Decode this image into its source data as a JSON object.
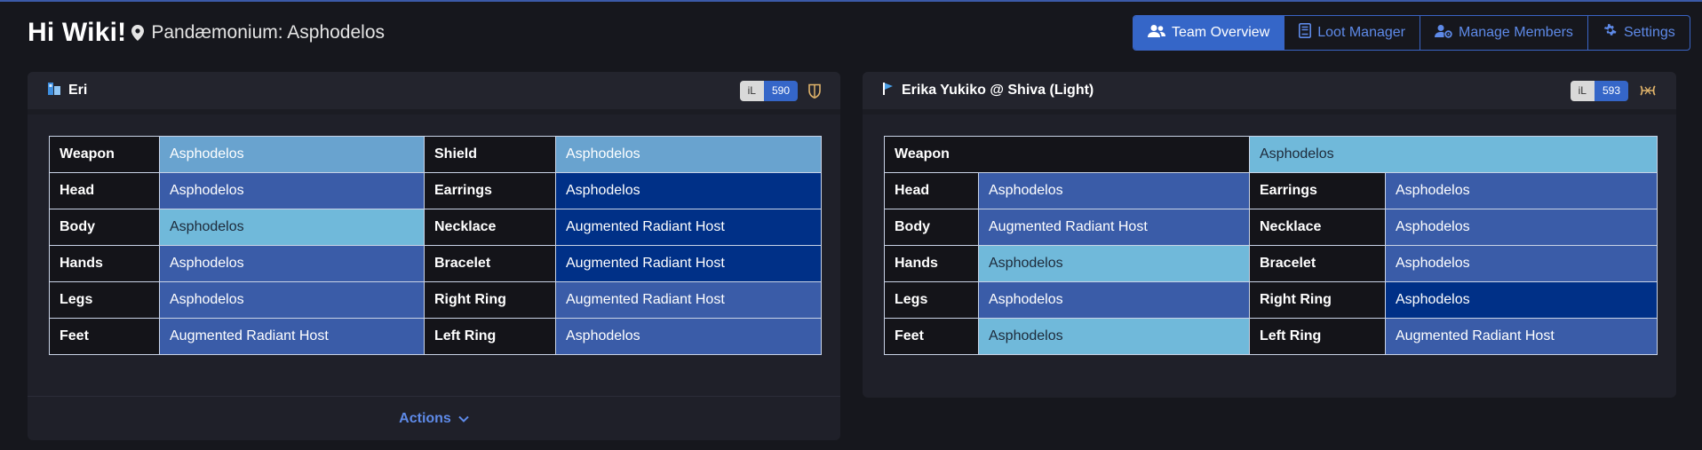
{
  "header": {
    "greeting": "Hi Wiki!",
    "location": "Pandæmonium: Asphodelos"
  },
  "nav": [
    {
      "label": "Team Overview",
      "icon": "users-icon",
      "active": true
    },
    {
      "label": "Loot Manager",
      "icon": "book-icon",
      "active": false
    },
    {
      "label": "Manage Members",
      "icon": "user-cog-icon",
      "active": false
    },
    {
      "label": "Settings",
      "icon": "gear-icon",
      "active": false
    }
  ],
  "colors": {
    "light": "#70b9da",
    "mid": "#69a3cf",
    "blue": "#3a5ca8",
    "navy": "#003087",
    "accent": "#3566c8"
  },
  "members": [
    {
      "name": "Eri",
      "job_icon": "paladin-job-icon",
      "il_label": "iL",
      "il_value": "590",
      "role_icon": "tank-shield-icon",
      "actions_label": "Actions",
      "rows": [
        [
          {
            "label": "Weapon",
            "value": "Asphodelos",
            "tone": "mid"
          },
          {
            "label": "Shield",
            "value": "Asphodelos",
            "tone": "mid"
          }
        ],
        [
          {
            "label": "Head",
            "value": "Asphodelos",
            "tone": "blue"
          },
          {
            "label": "Earrings",
            "value": "Asphodelos",
            "tone": "navy"
          }
        ],
        [
          {
            "label": "Body",
            "value": "Asphodelos",
            "tone": "light"
          },
          {
            "label": "Necklace",
            "value": "Augmented Radiant Host",
            "tone": "navy"
          }
        ],
        [
          {
            "label": "Hands",
            "value": "Asphodelos",
            "tone": "blue"
          },
          {
            "label": "Bracelet",
            "value": "Augmented Radiant Host",
            "tone": "navy"
          }
        ],
        [
          {
            "label": "Legs",
            "value": "Asphodelos",
            "tone": "blue"
          },
          {
            "label": "Right Ring",
            "value": "Augmented Radiant Host",
            "tone": "blue"
          }
        ],
        [
          {
            "label": "Feet",
            "value": "Augmented Radiant Host",
            "tone": "blue"
          },
          {
            "label": "Left Ring",
            "value": "Asphodelos",
            "tone": "blue"
          }
        ]
      ]
    },
    {
      "name": "Erika Yukiko @ Shiva (Light)",
      "job_icon": "dancer-job-icon",
      "il_label": "iL",
      "il_value": "593",
      "role_icon": "ranged-dps-icon",
      "weapon": {
        "label": "Weapon",
        "value": "Asphodelos",
        "tone": "light"
      },
      "rows": [
        [
          {
            "label": "Head",
            "value": "Asphodelos",
            "tone": "blue"
          },
          {
            "label": "Earrings",
            "value": "Asphodelos",
            "tone": "blue"
          }
        ],
        [
          {
            "label": "Body",
            "value": "Augmented Radiant Host",
            "tone": "blue"
          },
          {
            "label": "Necklace",
            "value": "Asphodelos",
            "tone": "blue"
          }
        ],
        [
          {
            "label": "Hands",
            "value": "Asphodelos",
            "tone": "light"
          },
          {
            "label": "Bracelet",
            "value": "Asphodelos",
            "tone": "blue"
          }
        ],
        [
          {
            "label": "Legs",
            "value": "Asphodelos",
            "tone": "blue"
          },
          {
            "label": "Right Ring",
            "value": "Asphodelos",
            "tone": "navy"
          }
        ],
        [
          {
            "label": "Feet",
            "value": "Asphodelos",
            "tone": "light"
          },
          {
            "label": "Left Ring",
            "value": "Augmented Radiant Host",
            "tone": "blue"
          }
        ]
      ]
    }
  ]
}
